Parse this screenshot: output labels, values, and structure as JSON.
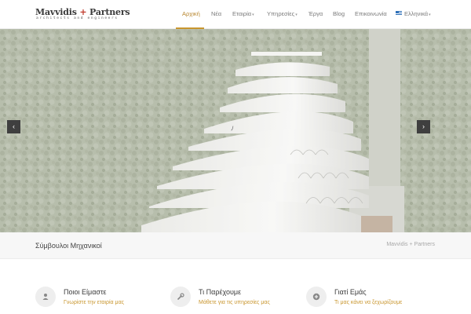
{
  "logo": {
    "name": "Mavvidis",
    "plus": "+",
    "name2": "Partners",
    "subtitle": "architects and engineers"
  },
  "nav": {
    "items": [
      {
        "label": "Αρχική",
        "active": true
      },
      {
        "label": "Νέα"
      },
      {
        "label": "Εταιρία",
        "dropdown": true
      },
      {
        "label": "Υπηρεσίες",
        "dropdown": true
      },
      {
        "label": "Έργα"
      },
      {
        "label": "Blog"
      },
      {
        "label": "Επικοινωνία"
      },
      {
        "label": "Ελληνικά",
        "dropdown": true,
        "icon": "greek-flag-icon"
      }
    ],
    "caret": "▾"
  },
  "slider": {
    "prev": "‹",
    "next": "›",
    "loading": "ﾉ"
  },
  "title_bar": {
    "title": "Σύμβουλοι Μηχανικοί",
    "breadcrumb": "Mavvidis + Partners"
  },
  "features": [
    {
      "icon": "user-icon",
      "title": "Ποιοι Είμαστε",
      "link": "Γνωρίστε την εταιρία μας"
    },
    {
      "icon": "wrench-icon",
      "title": "Τι Παρέχουμε",
      "link": "Μάθετε για τις υπηρεσίες μας"
    },
    {
      "icon": "plus-circle-icon",
      "title": "Γιατί Εμάς",
      "link": "Τι μας κάνει να ξεχωρίζουμε"
    }
  ],
  "colors": {
    "accent": "#c9962e",
    "hero_overlay": "#bfc2b6",
    "dark_button": "#3f3f3f"
  }
}
